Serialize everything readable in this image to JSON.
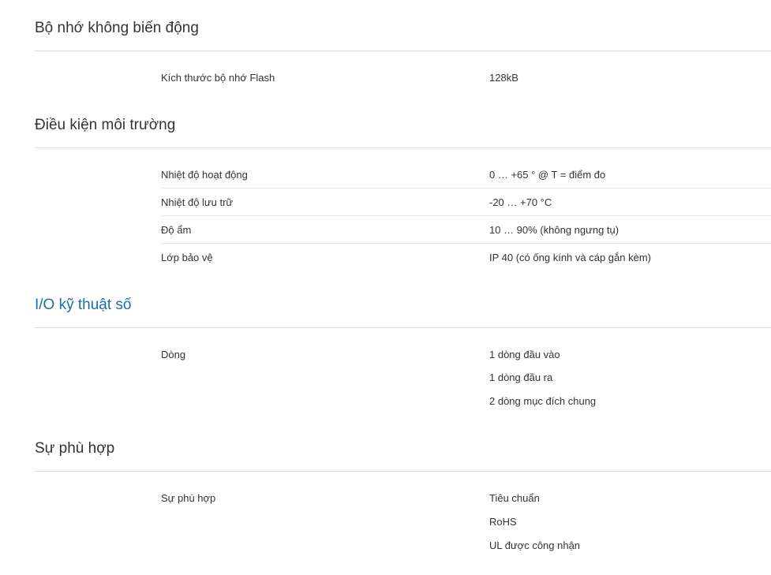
{
  "sections": [
    {
      "title": "Bộ nhớ không biến động",
      "rows": [
        {
          "label": "Kích thước bộ nhớ Flash",
          "values": [
            "128kB"
          ]
        }
      ]
    },
    {
      "title": "Điều kiện môi trường",
      "rows": [
        {
          "label": "Nhiệt độ hoạt động",
          "values": [
            "0 … +65 ° @ T = điểm đo"
          ]
        },
        {
          "label": "Nhiệt độ lưu trữ",
          "values": [
            "-20 … +70 °C"
          ]
        },
        {
          "label": "Độ ẩm",
          "values": [
            "10 … 90% (không ngưng tụ)"
          ]
        },
        {
          "label": "Lớp bảo vệ",
          "values": [
            "IP 40 (có ống kính và cáp gắn kèm)"
          ]
        }
      ]
    },
    {
      "title": "I/O kỹ thuật số",
      "rows": [
        {
          "label": "Dòng",
          "values": [
            "1 dòng đầu vào",
            "1 dòng đầu ra",
            "2 dòng mục đích chung"
          ]
        }
      ]
    },
    {
      "title": "Sự phù hợp",
      "rows": [
        {
          "label": "Sự phù hợp",
          "values": [
            "Tiêu chuẩn",
            "RoHS",
            "UL được công nhận"
          ]
        }
      ]
    }
  ],
  "colors": {
    "text": "#333333",
    "link_heading": "#1a6fa8",
    "divider": "#dddddd"
  }
}
